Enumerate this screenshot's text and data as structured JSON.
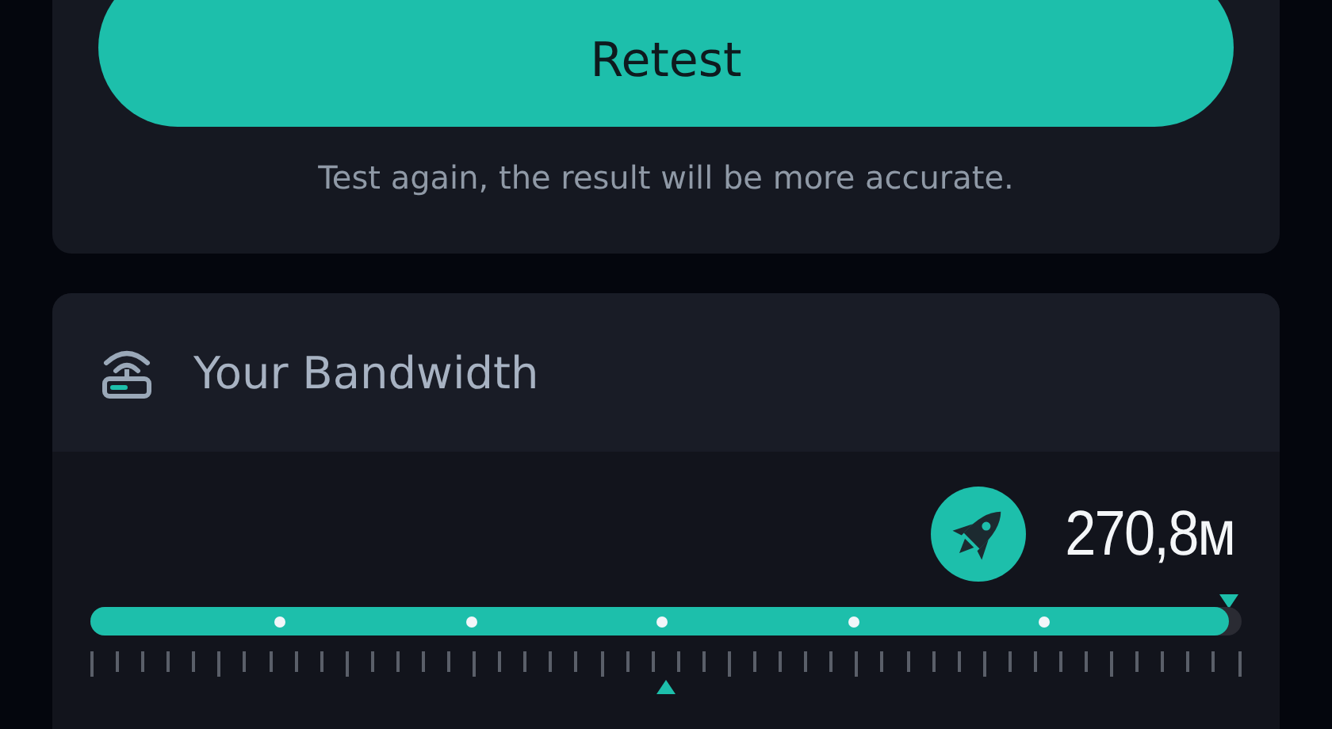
{
  "retest_card": {
    "button": "Retest",
    "hint": "Test again, the result will be more accurate."
  },
  "bandwidth_card": {
    "title": "Your Bandwidth",
    "speed": "270,8м",
    "level": 0.989
  }
}
